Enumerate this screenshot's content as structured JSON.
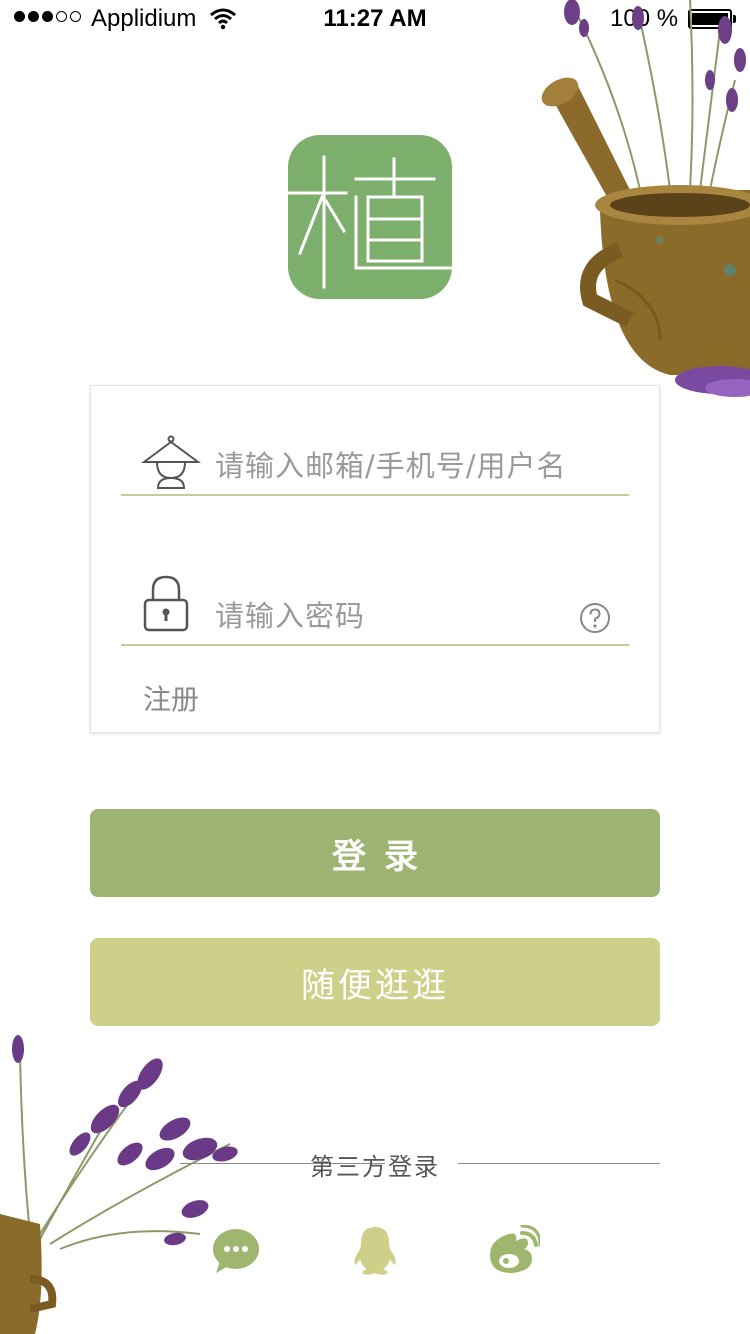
{
  "status_bar": {
    "carrier": "Applidium",
    "time": "11:27 AM",
    "battery": "100 %"
  },
  "logo": {
    "char": "植",
    "color": "#7cae6c"
  },
  "form": {
    "username_placeholder": "请输入邮箱/手机号/用户名",
    "password_placeholder": "请输入密码",
    "register_label": "注册",
    "username_icon": "user-icon",
    "password_icon": "lock-icon",
    "help_icon": "question-icon"
  },
  "buttons": {
    "login_label": "登录",
    "browse_label": "随便逛逛",
    "login_color": "#9db473",
    "browse_color": "#ced08a"
  },
  "third_party": {
    "label": "第三方登录",
    "providers": [
      "wechat-icon",
      "qq-icon",
      "weibo-icon"
    ]
  }
}
